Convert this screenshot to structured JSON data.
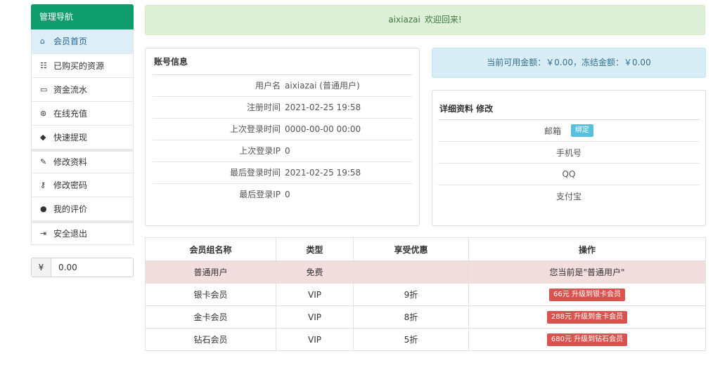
{
  "sidebar": {
    "header": "管理导航",
    "items": [
      {
        "icon": "home-icon",
        "glyph": "⌂",
        "label": "会员首页"
      },
      {
        "icon": "list-icon",
        "glyph": "☷",
        "label": "已购买的资源"
      },
      {
        "icon": "card-icon",
        "glyph": "▭",
        "label": "资金流水"
      },
      {
        "icon": "coin-icon",
        "glyph": "⊛",
        "label": "在线充值"
      },
      {
        "icon": "tag-icon",
        "glyph": "◆",
        "label": "快速提现"
      },
      {
        "icon": "pencil-icon",
        "glyph": "✎",
        "label": "修改资料"
      },
      {
        "icon": "key-icon",
        "glyph": "⚷",
        "label": "修改密码"
      },
      {
        "icon": "comment-icon",
        "glyph": "●",
        "label": "我的评价"
      },
      {
        "icon": "logout-icon",
        "glyph": "⇥",
        "label": "安全退出"
      }
    ],
    "balance_currency": "¥",
    "balance_amount": "0.00"
  },
  "welcome": {
    "username": "aixiazai",
    "message": "欢迎回来!"
  },
  "account": {
    "title": "账号信息",
    "rows": [
      {
        "label": "用户名",
        "value": "aixiazai (普通用户)"
      },
      {
        "label": "注册时间",
        "value": "2021-02-25 19:58"
      },
      {
        "label": "上次登录时间",
        "value": "0000-00-00 00:00"
      },
      {
        "label": "上次登录IP",
        "value": "0"
      },
      {
        "label": "最后登录时间",
        "value": "2021-02-25 19:58"
      },
      {
        "label": "最后登录IP",
        "value": "0"
      }
    ]
  },
  "funds": {
    "text": "当前可用金额：￥0.00，冻结金额：￥0.00"
  },
  "detail": {
    "title": "详细资料 修改",
    "rows": [
      {
        "label": "邮箱",
        "button": "绑定"
      },
      {
        "label": "手机号"
      },
      {
        "label": "QQ"
      },
      {
        "label": "支付宝"
      }
    ]
  },
  "groups": {
    "headers": [
      "会员组名称",
      "类型",
      "享受优惠",
      "操作"
    ],
    "rows": [
      {
        "name": "普通用户",
        "type": "免费",
        "discount": "",
        "action": "您当前是\"普通用户\"",
        "current": true
      },
      {
        "name": "银卡会员",
        "type": "VIP",
        "discount": "9折",
        "action": "66元 升级到银卡会员",
        "current": false
      },
      {
        "name": "金卡会员",
        "type": "VIP",
        "discount": "8折",
        "action": "288元 升级到金卡会员",
        "current": false
      },
      {
        "name": "钻石会员",
        "type": "VIP",
        "discount": "5折",
        "action": "680元 升级到钻石会员",
        "current": false
      }
    ]
  },
  "colors": {
    "nav_header": "#0f9d6e",
    "welcome_bg": "#dff0d8",
    "info_bg": "#d9edf7",
    "current_row_bg": "#f2dede",
    "upgrade_button": "#d9534f",
    "bind_button": "#5bc0de"
  }
}
